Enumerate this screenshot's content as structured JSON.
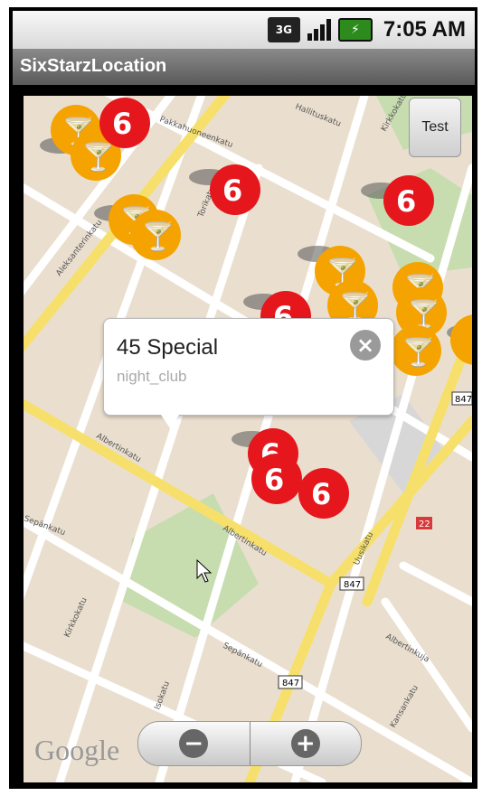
{
  "status_bar": {
    "network": "3G",
    "time": "7:05 AM"
  },
  "app": {
    "title": "SixStarzLocation"
  },
  "map": {
    "test_button": "Test",
    "popup": {
      "title": "45 Special",
      "subtitle": "night_club"
    },
    "zoom": {
      "out_icon": "zoom-out-icon",
      "in_icon": "zoom-in-icon"
    },
    "attribution": "Google",
    "street_labels": [
      "Aleksanterinkatu",
      "Pakkahuoneenkatu",
      "Torikatu",
      "Hallituskatu",
      "Kirkkokatu",
      "Isokatu",
      "Albertinkatu",
      "Sepänkatu",
      "Uusikatu",
      "Kansankatu",
      "Albertinkuja",
      "Kirkkokatu",
      "Sepänkatu"
    ],
    "road_badges": [
      "847",
      "847",
      "847",
      "22"
    ]
  },
  "colors": {
    "marker_bar": "#f5a300",
    "marker_club": "#e5171d",
    "road_major": "#f6e06b",
    "park": "#c7ddb0",
    "map_bg": "#eadfcf"
  }
}
